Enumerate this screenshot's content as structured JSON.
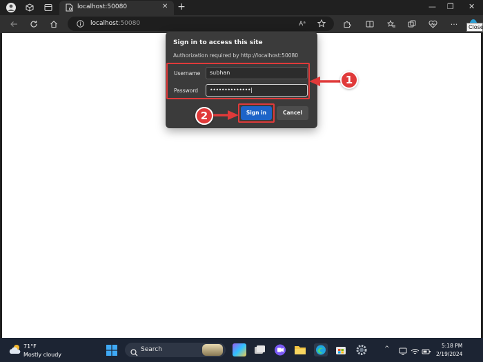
{
  "browser": {
    "tab": {
      "title": "localhost:50080",
      "close_glyph": "✕"
    },
    "new_tab_glyph": "+",
    "window_controls": {
      "minimize": "—",
      "restore": "❐",
      "close": "✕"
    },
    "address": {
      "host": "localhost",
      "port": ":50080"
    },
    "read_aloud_glyph": "Aᵃ",
    "close_tooltip": "Close",
    "more_glyph": "···"
  },
  "dialog": {
    "title": "Sign in to access this site",
    "subtitle": "Authorization required by http://localhost:50080",
    "username_label": "Username",
    "username_value": "subhan",
    "password_label": "Password",
    "password_value": "••••••••••••••|",
    "sign_in_label": "Sign in",
    "cancel_label": "Cancel"
  },
  "callouts": {
    "one": "1",
    "two": "2"
  },
  "taskbar": {
    "weather_temp": "71°F",
    "weather_desc": "Mostly cloudy",
    "search_label": "Search",
    "time": "5:18 PM",
    "date": "2/19/2024",
    "tray_chevron": "^"
  },
  "colors": {
    "accent_red": "#e03a3a",
    "sign_in_blue": "#1e64c8",
    "dialog_bg": "#3b3b3b",
    "taskbar_bg": "#1c2433"
  }
}
